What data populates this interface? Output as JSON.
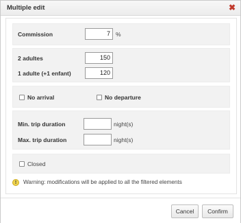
{
  "dialog": {
    "title": "Multiple edit",
    "close_icon": "close-icon"
  },
  "commission": {
    "label": "Commission",
    "value": "7",
    "unit": "%"
  },
  "prices": {
    "row1_label": "2 adultes",
    "row1_value": "150",
    "row2_label": "1 adulte (+1 enfant)",
    "row2_value": "120"
  },
  "flags": {
    "no_arrival_label": "No arrival",
    "no_departure_label": "No departure"
  },
  "duration": {
    "min_label": "Min. trip duration",
    "min_value": "",
    "min_unit": "night(s)",
    "max_label": "Max. trip duration",
    "max_value": "",
    "max_unit": "night(s)"
  },
  "closed": {
    "label": "Closed"
  },
  "warning": {
    "icon": "warning-icon",
    "text": "Warning: modifications will be applied to all the filtered elements"
  },
  "buttons": {
    "cancel_label": "Cancel",
    "confirm_label": "Confirm"
  },
  "colors": {
    "close": "#c0392b",
    "panel_bg": "#f2f2f2",
    "warning_icon": "#f1d54e"
  }
}
